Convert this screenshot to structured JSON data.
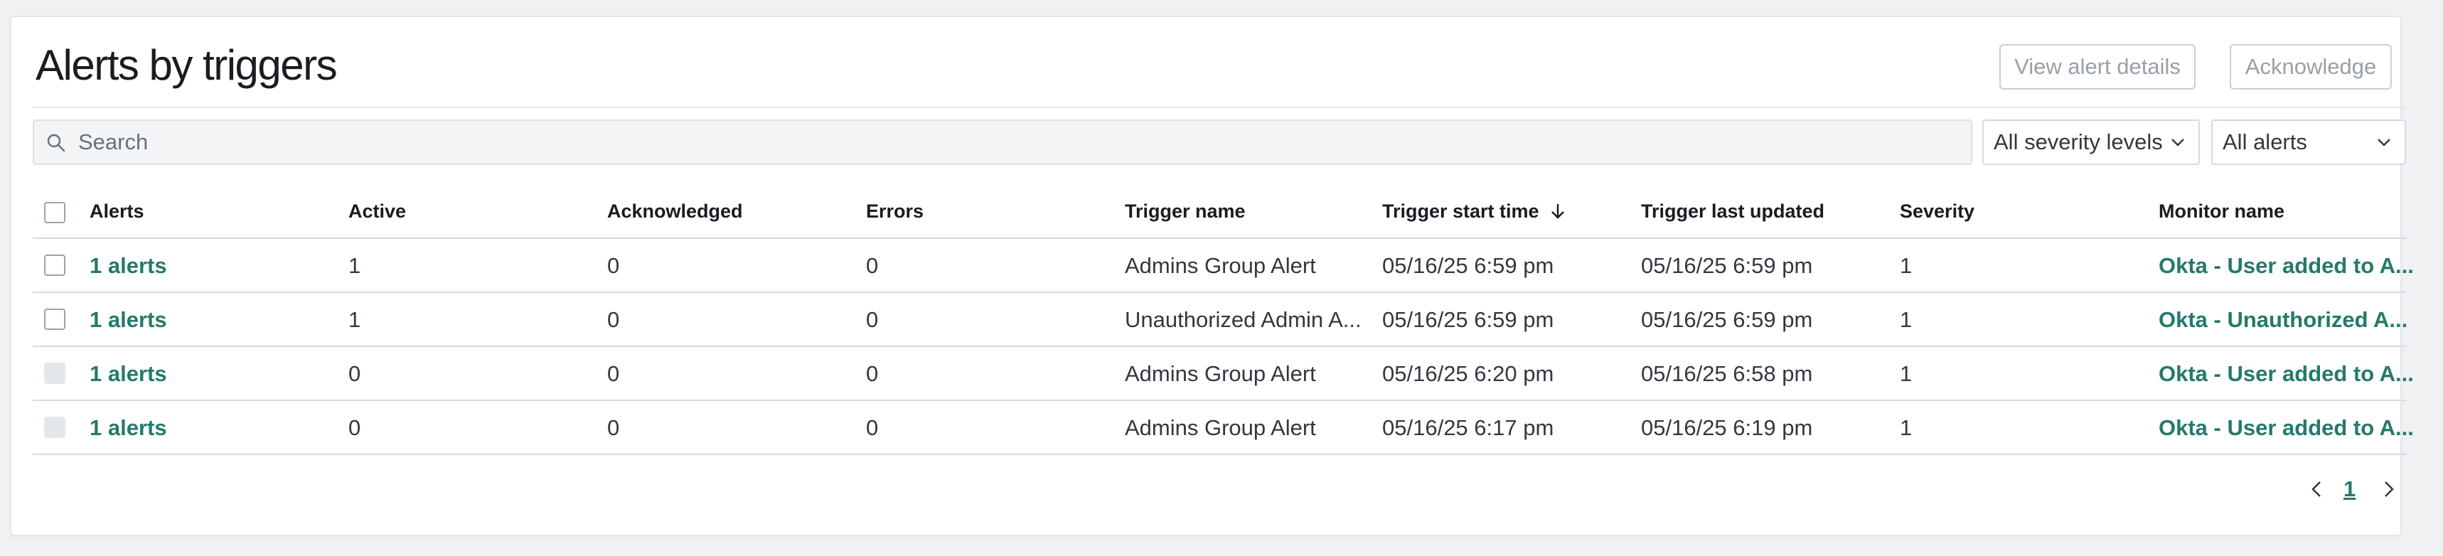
{
  "header": {
    "title": "Alerts by triggers",
    "view_button": "View alert details",
    "ack_button": "Acknowledge"
  },
  "search": {
    "placeholder": "Search",
    "icon": "search-icon"
  },
  "filters": {
    "severity": "All severity levels",
    "alerts": "All alerts"
  },
  "table": {
    "columns": [
      "Alerts",
      "Active",
      "Acknowledged",
      "Errors",
      "Trigger name",
      "Trigger start time",
      "Trigger last updated",
      "Severity",
      "Monitor name"
    ],
    "sort_column": "Trigger start time",
    "sort_direction": "descending",
    "rows": [
      {
        "alerts": "1 alerts",
        "active": "1",
        "acknowledged": "0",
        "errors": "0",
        "trigger_name": "Admins Group Alert",
        "start_time": "05/16/25 6:59 pm",
        "last_updated": "05/16/25 6:59 pm",
        "severity": "1",
        "monitor_name": "Okta - User added to A...",
        "selectable": true
      },
      {
        "alerts": "1 alerts",
        "active": "1",
        "acknowledged": "0",
        "errors": "0",
        "trigger_name": "Unauthorized Admin A...",
        "start_time": "05/16/25 6:59 pm",
        "last_updated": "05/16/25 6:59 pm",
        "severity": "1",
        "monitor_name": "Okta - Unauthorized A...",
        "selectable": true
      },
      {
        "alerts": "1 alerts",
        "active": "0",
        "acknowledged": "0",
        "errors": "0",
        "trigger_name": "Admins Group Alert",
        "start_time": "05/16/25 6:20 pm",
        "last_updated": "05/16/25 6:58 pm",
        "severity": "1",
        "monitor_name": "Okta - User added to A...",
        "selectable": false
      },
      {
        "alerts": "1 alerts",
        "active": "0",
        "acknowledged": "0",
        "errors": "0",
        "trigger_name": "Admins Group Alert",
        "start_time": "05/16/25 6:17 pm",
        "last_updated": "05/16/25 6:19 pm",
        "severity": "1",
        "monitor_name": "Okta - User added to A...",
        "selectable": false
      }
    ]
  },
  "pagination": {
    "current_page": "1"
  },
  "colors": {
    "link": "#257a69",
    "text": "#343741",
    "border": "#d3dae6"
  }
}
